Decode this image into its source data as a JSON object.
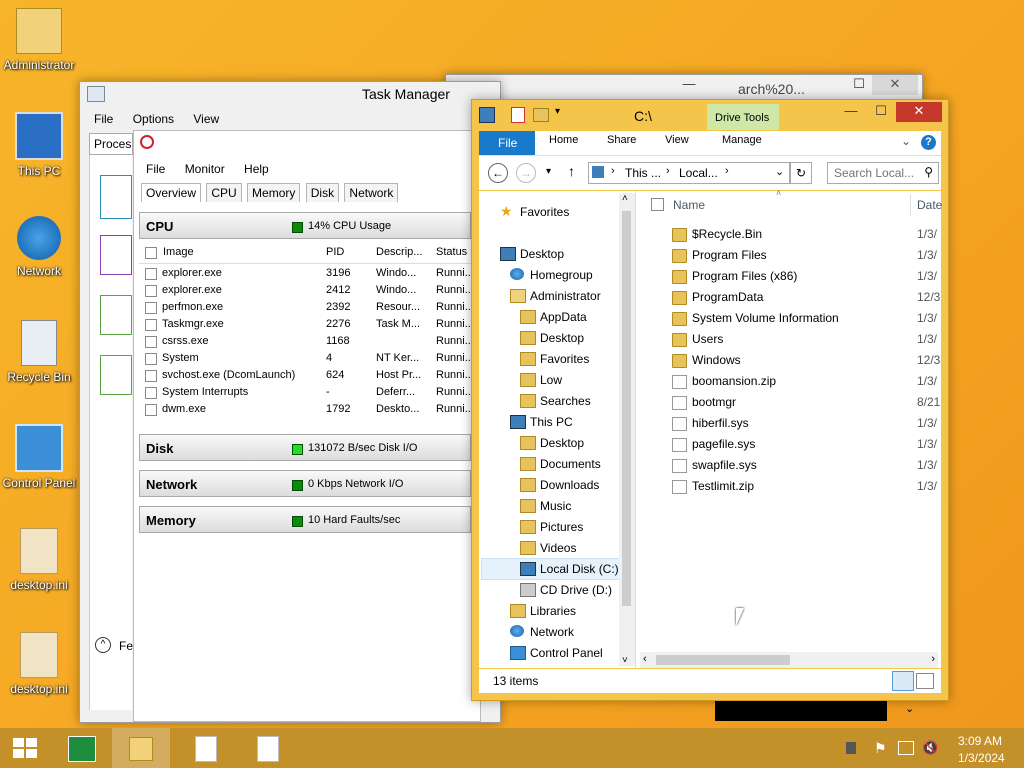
{
  "desktop": {
    "icons": [
      {
        "label": "Administrator",
        "icon": "user-folder-icon"
      },
      {
        "label": "This PC",
        "icon": "computer-icon"
      },
      {
        "label": "Network",
        "icon": "network-globe-icon"
      },
      {
        "label": "Recycle Bin",
        "icon": "recycle-bin-icon"
      },
      {
        "label": "Control Panel",
        "icon": "control-panel-icon"
      },
      {
        "label": "desktop.ini",
        "icon": "settings-file-icon"
      },
      {
        "label": "desktop.ini",
        "icon": "settings-file-icon"
      }
    ]
  },
  "back_window": {
    "title": "arch%20..."
  },
  "task_manager": {
    "title": "Task Manager",
    "menu": [
      "File",
      "Options",
      "View"
    ],
    "tab_partial": "Proces",
    "fewer_partial": "Fe"
  },
  "resmon": {
    "menu": [
      "File",
      "Monitor",
      "Help"
    ],
    "tabs": [
      "Overview",
      "CPU",
      "Memory",
      "Disk",
      "Network"
    ],
    "cpu": {
      "name": "CPU",
      "status": "14% CPU Usage"
    },
    "columns": [
      "Image",
      "PID",
      "Descrip...",
      "Status"
    ],
    "processes": [
      {
        "image": "explorer.exe",
        "pid": "3196",
        "desc": "Windo...",
        "status": "Runni..."
      },
      {
        "image": "explorer.exe",
        "pid": "2412",
        "desc": "Windo...",
        "status": "Runni..."
      },
      {
        "image": "perfmon.exe",
        "pid": "2392",
        "desc": "Resour...",
        "status": "Runni..."
      },
      {
        "image": "Taskmgr.exe",
        "pid": "2276",
        "desc": "Task M...",
        "status": "Runni..."
      },
      {
        "image": "csrss.exe",
        "pid": "1168",
        "desc": "",
        "status": "Runni..."
      },
      {
        "image": "System",
        "pid": "4",
        "desc": "NT Ker...",
        "status": "Runni..."
      },
      {
        "image": "svchost.exe (DcomLaunch)",
        "pid": "624",
        "desc": "Host Pr...",
        "status": "Runni..."
      },
      {
        "image": "System Interrupts",
        "pid": "-",
        "desc": "Deferr...",
        "status": "Runni..."
      },
      {
        "image": "dwm.exe",
        "pid": "1792",
        "desc": "Deskto...",
        "status": "Runni..."
      }
    ],
    "disk": {
      "name": "Disk",
      "status": "131072 B/sec Disk I/O"
    },
    "network": {
      "name": "Network",
      "status": "0 Kbps Network I/O"
    },
    "memory": {
      "name": "Memory",
      "status": "10 Hard Faults/sec"
    }
  },
  "explorer": {
    "title": "C:\\",
    "drive_tools": "Drive Tools",
    "ribbon_tabs": [
      "File",
      "Home",
      "Share",
      "View",
      "Manage"
    ],
    "address": {
      "part1": "This ...",
      "part2": "Local..."
    },
    "search_placeholder": "Search Local...",
    "columns": {
      "name": "Name",
      "date": "Date"
    },
    "nav": [
      {
        "label": "Favorites",
        "type": "star"
      },
      {
        "label": "Desktop",
        "type": "desktop"
      },
      {
        "label": "Homegroup",
        "type": "homegroup"
      },
      {
        "label": "Administrator",
        "type": "user"
      },
      {
        "label": "AppData",
        "type": "folder"
      },
      {
        "label": "Desktop",
        "type": "folder"
      },
      {
        "label": "Favorites",
        "type": "folder"
      },
      {
        "label": "Low",
        "type": "folder"
      },
      {
        "label": "Searches",
        "type": "folder"
      },
      {
        "label": "This PC",
        "type": "pc"
      },
      {
        "label": "Desktop",
        "type": "folder"
      },
      {
        "label": "Documents",
        "type": "folder"
      },
      {
        "label": "Downloads",
        "type": "folder"
      },
      {
        "label": "Music",
        "type": "folder"
      },
      {
        "label": "Pictures",
        "type": "folder"
      },
      {
        "label": "Videos",
        "type": "folder"
      },
      {
        "label": "Local Disk (C:)",
        "type": "drive"
      },
      {
        "label": "CD Drive (D:)",
        "type": "cd"
      },
      {
        "label": "Libraries",
        "type": "folder"
      },
      {
        "label": "Network",
        "type": "network"
      },
      {
        "label": "Control Panel",
        "type": "control"
      }
    ],
    "files": [
      {
        "name": "$Recycle.Bin",
        "date": "1/3/",
        "type": "folder"
      },
      {
        "name": "Program Files",
        "date": "1/3/",
        "type": "folder"
      },
      {
        "name": "Program Files (x86)",
        "date": "1/3/",
        "type": "folder"
      },
      {
        "name": "ProgramData",
        "date": "12/3",
        "type": "folder"
      },
      {
        "name": "System Volume Information",
        "date": "1/3/",
        "type": "folder"
      },
      {
        "name": "Users",
        "date": "1/3/",
        "type": "folder"
      },
      {
        "name": "Windows",
        "date": "12/3",
        "type": "folder"
      },
      {
        "name": "boomansion.zip",
        "date": "1/3/",
        "type": "file"
      },
      {
        "name": "bootmgr",
        "date": "8/21",
        "type": "file"
      },
      {
        "name": "hiberfil.sys",
        "date": "1/3/",
        "type": "file"
      },
      {
        "name": "pagefile.sys",
        "date": "1/3/",
        "type": "file"
      },
      {
        "name": "swapfile.sys",
        "date": "1/3/",
        "type": "file"
      },
      {
        "name": "Testlimit.zip",
        "date": "1/3/",
        "type": "file"
      }
    ],
    "status": "13 items"
  },
  "taskbar": {
    "time": "3:09 AM",
    "date": "1/3/2024"
  },
  "colors": {
    "desktop": "#f5a623",
    "taskbar": "#c4902a",
    "explorer_file_tab": "#1979ca",
    "close_button": "#c7382c",
    "drive_tools": "#cfe8a7"
  }
}
